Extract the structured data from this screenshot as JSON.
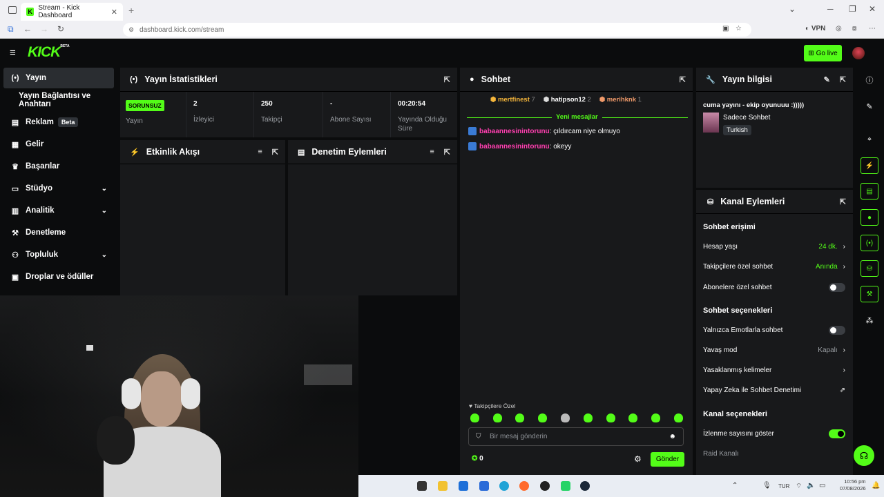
{
  "browser": {
    "tab_title": "Stream - Kick Dashboard",
    "tab_icon": "K",
    "url": "dashboard.kick.com/stream",
    "vpn_label": "VPN",
    "win": {
      "min": "─",
      "restore": "❐",
      "close": "✕"
    }
  },
  "header": {
    "logo": "KICK",
    "logo_sup": "BETA",
    "go_live": "Go live"
  },
  "sidebar": {
    "items": [
      {
        "label": "Yayın",
        "icon": "(•)"
      },
      {
        "label": "Yayın Bağlantısı ve Anahtarı",
        "icon": ""
      },
      {
        "label": "Reklam",
        "icon": "▤",
        "badge": "Beta"
      },
      {
        "label": "Gelir",
        "icon": "▦"
      },
      {
        "label": "Başarılar",
        "icon": "♛"
      },
      {
        "label": "Stüdyo",
        "icon": "▭"
      },
      {
        "label": "Analitik",
        "icon": "▥"
      },
      {
        "label": "Denetleme",
        "icon": "⚒"
      },
      {
        "label": "Topluluk",
        "icon": "⚇"
      },
      {
        "label": "Droplar ve ödüller",
        "icon": "▣"
      }
    ]
  },
  "stats_panel": {
    "title": "Yayın İstatistikleri",
    "stats": [
      {
        "value": "SORUNSUZ",
        "label": "Yayın"
      },
      {
        "value": "2",
        "label": "İzleyici"
      },
      {
        "value": "250",
        "label": "Takipçi"
      },
      {
        "value": "-",
        "label": "Abone Sayısı"
      },
      {
        "value": "00:20:54",
        "label": "Yayında Olduğu Süre"
      }
    ]
  },
  "activity_panel": {
    "title": "Etkinlik Akışı"
  },
  "moderation_panel": {
    "title": "Denetim Eylemleri"
  },
  "chat": {
    "title": "Sohbet",
    "top_gifters": [
      {
        "name": "mertfinest",
        "count": "7",
        "color": "#f5b63b"
      },
      {
        "name": "hatipson12",
        "count": "2",
        "color": "#ffffff"
      },
      {
        "name": "merihknk",
        "count": "1",
        "color": "#f09a6a"
      }
    ],
    "new_messages": "Yeni mesajlar",
    "messages": [
      {
        "user": "babaannesinintorunu",
        "text": ": çıldırcam niye olmuyo"
      },
      {
        "user": "babaannesinintorunu",
        "text": ": okeyy"
      }
    ],
    "followers_only": "Takipçilere Özel",
    "input_placeholder": "Bir mesaj gönderin",
    "points": "0",
    "send": "Gönder"
  },
  "stream_info": {
    "title": "Yayın bilgisi",
    "stream_title": "cuma yayını - ekip oyunuuu :)))))",
    "category": "Sadece Sohbet",
    "language": "Turkish"
  },
  "channel_actions": {
    "title": "Kanal Eylemleri",
    "chat_access": "Sohbet erişimi",
    "account_age": {
      "label": "Hesap yaşı",
      "value": "24 dk."
    },
    "followers_chat": {
      "label": "Takipçilere özel sohbet",
      "value": "Anında"
    },
    "subscribers_chat": {
      "label": "Abonelere özel sohbet",
      "on": false
    },
    "chat_options": "Sohbet seçenekleri",
    "emote_only": {
      "label": "Yalnızca Emotlarla sohbet",
      "on": false
    },
    "slow_mode": {
      "label": "Yavaş mod",
      "value": "Kapalı"
    },
    "banned_words": {
      "label": "Yasaklanmış kelimeler"
    },
    "ai_moderation": {
      "label": "Yapay Zeka ile Sohbet Denetimi"
    },
    "channel_options": "Kanal seçenekleri",
    "show_viewers": {
      "label": "İzlenme sayısını göster",
      "on": true
    },
    "raid": {
      "label": "Raid Kanalı"
    }
  },
  "taskbar": {
    "lang": "TUR",
    "time": "10:56 pm",
    "date": "07/08/2026"
  },
  "colors": {
    "accent": "#53fc18",
    "username": "#ff3fb0"
  }
}
